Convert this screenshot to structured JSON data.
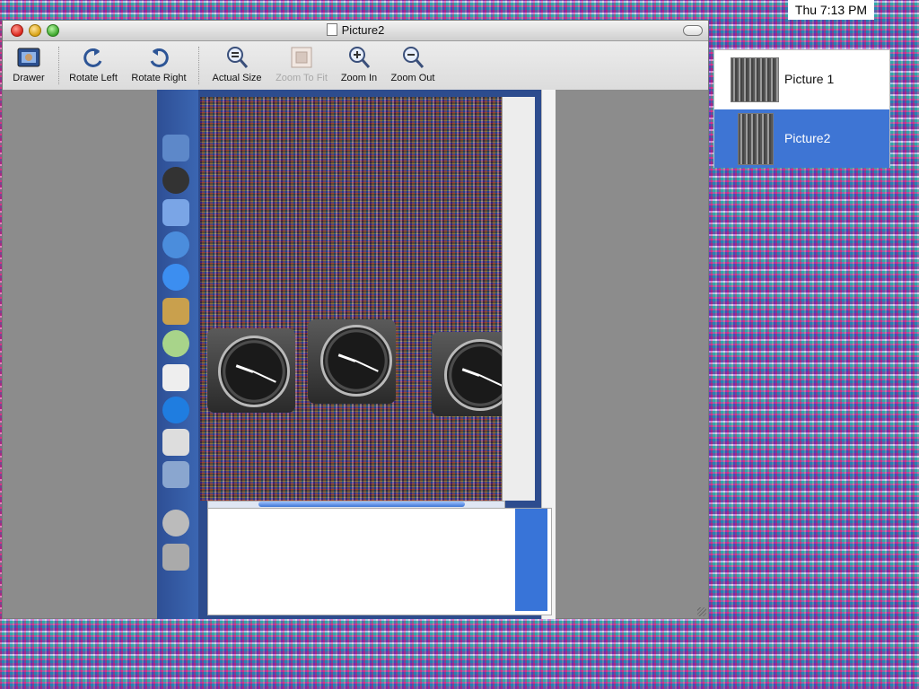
{
  "menubar": {
    "clock": "Thu 7:13 PM"
  },
  "window": {
    "title": "Picture2",
    "toolbar": {
      "items": [
        {
          "label": "Drawer",
          "icon": "drawer-icon",
          "enabled": true
        },
        {
          "label": "Rotate Left",
          "icon": "rotate-left-icon",
          "enabled": true
        },
        {
          "label": "Rotate Right",
          "icon": "rotate-right-icon",
          "enabled": true
        },
        {
          "label": "Actual Size",
          "icon": "actual-size-icon",
          "enabled": true
        },
        {
          "label": "Zoom To Fit",
          "icon": "zoom-to-fit-icon",
          "enabled": false
        },
        {
          "label": "Zoom In",
          "icon": "zoom-in-icon",
          "enabled": true
        },
        {
          "label": "Zoom Out",
          "icon": "zoom-out-icon",
          "enabled": true
        }
      ]
    }
  },
  "drawer": {
    "items": [
      {
        "label": "Picture 1",
        "selected": false
      },
      {
        "label": "Picture2",
        "selected": true
      }
    ]
  },
  "colors": {
    "selection": "#3e75d4",
    "window_bg": "#8c8c8c"
  }
}
